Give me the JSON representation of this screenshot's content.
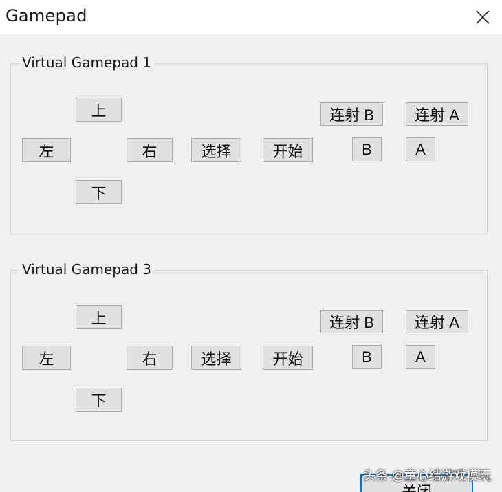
{
  "window": {
    "title": "Gamepad",
    "close_button_label": "关闭"
  },
  "groups": [
    {
      "label": "Virtual Gamepad 1",
      "buttons": {
        "up": "上",
        "down": "下",
        "left": "左",
        "right": "右",
        "select": "选择",
        "start": "开始",
        "turbo_b": "连射 B",
        "turbo_a": "连射 A",
        "b": "B",
        "a": "A"
      }
    },
    {
      "label": "Virtual Gamepad 3",
      "buttons": {
        "up": "上",
        "down": "下",
        "left": "左",
        "right": "右",
        "select": "选择",
        "start": "开始",
        "turbo_b": "连射 B",
        "turbo_a": "连射 A",
        "b": "B",
        "a": "A"
      }
    }
  ],
  "watermark": "头条 @童心结游戏模玩",
  "icons": {
    "close": "close-icon"
  },
  "colors": {
    "button_face": "#e1e1e1",
    "button_border": "#adadad",
    "focus_border": "#0078d7",
    "dialog_bg": "#f0f0f0"
  }
}
